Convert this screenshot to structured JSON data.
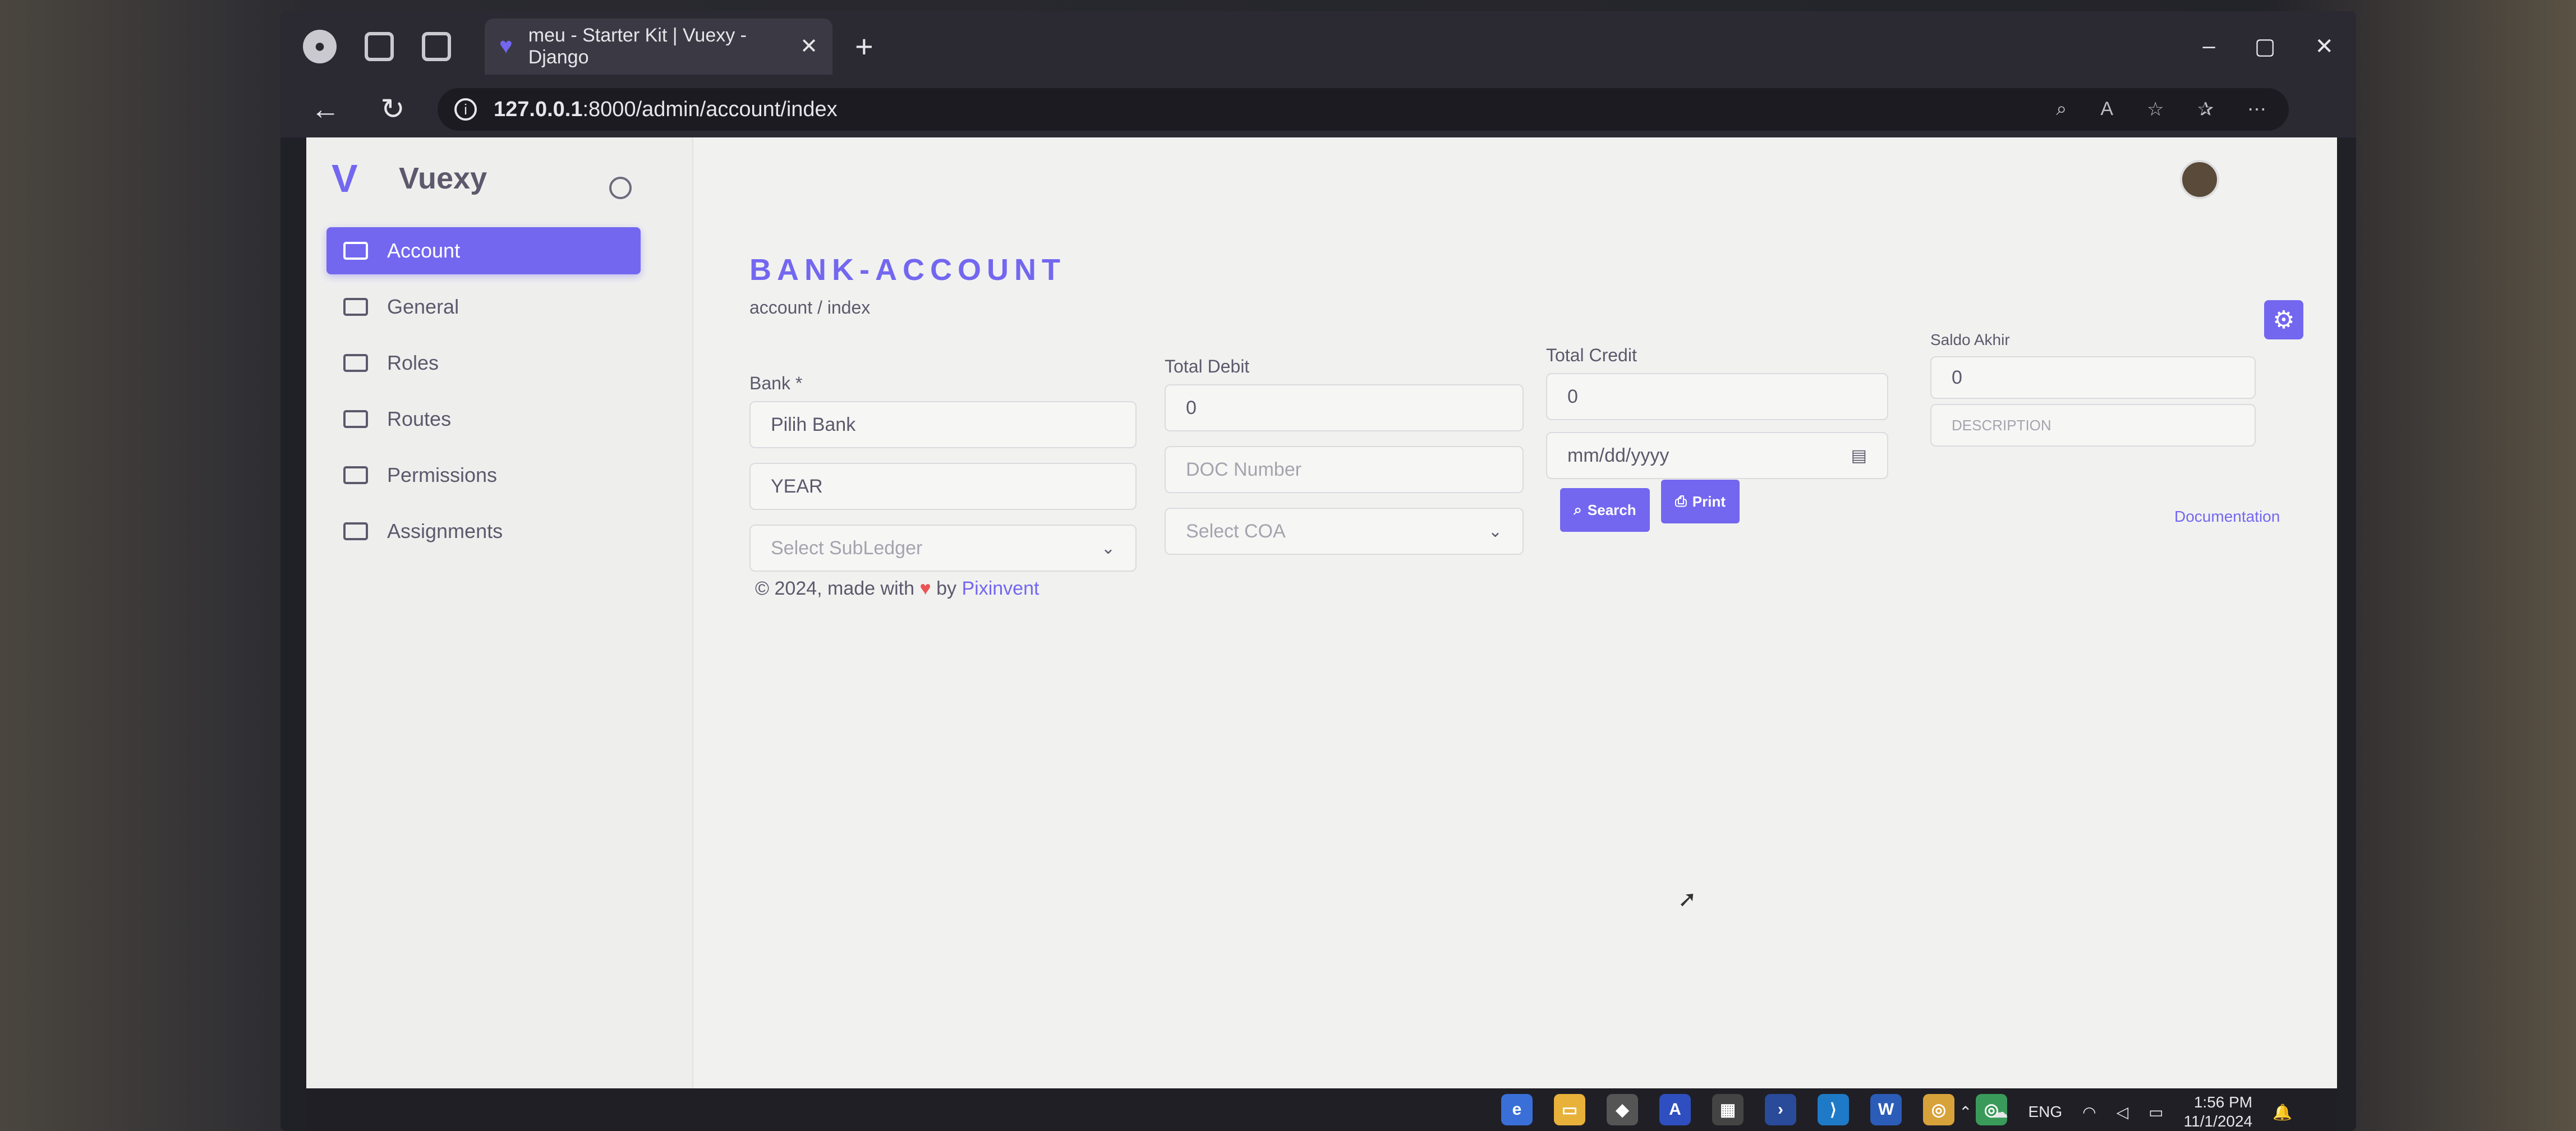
{
  "browser": {
    "tab_title": "meu - Starter Kit | Vuexy - Django",
    "tab_close": "✕",
    "new_tab": "+",
    "url_host": "127.0.0.1",
    "url_path": ":8000/admin/account/index",
    "window_controls": [
      "–",
      "▢",
      "✕"
    ]
  },
  "sidebar": {
    "brand": "Vuexy",
    "items": [
      {
        "label": "Account",
        "active": true
      },
      {
        "label": "General"
      },
      {
        "label": "Roles"
      },
      {
        "label": "Routes"
      },
      {
        "label": "Permissions"
      },
      {
        "label": "Assignments"
      }
    ]
  },
  "header": {
    "title": "BANK-ACCOUNT",
    "breadcrumb": "account / index"
  },
  "form": {
    "bank_label": "Bank *",
    "bank_value": "Pilih Bank",
    "total_debit_label": "Total Debit",
    "total_debit_value": "0",
    "total_credit_label": "Total Credit",
    "total_credit_value": "0",
    "saldo_label": "Saldo Akhir",
    "saldo_value": "0",
    "year_value": "YEAR",
    "doc_number_placeholder": "DOC Number",
    "date_value": "mm/dd/yyyy",
    "description_placeholder": "DESCRIPTION",
    "subledger_placeholder": "Select SubLedger",
    "coa_placeholder": "Select COA",
    "search_label": "Search",
    "print_label": "Print",
    "documentation_link": "Documentation"
  },
  "footer": {
    "prefix": "© 2024, made with",
    "by": "by",
    "link": "Pixinvent"
  },
  "taskbar": {
    "lang": "ENG",
    "time": "1:56 PM",
    "date": "11/1/2024"
  },
  "colors": {
    "accent": "#7367f0",
    "heart": "#ea5455"
  }
}
